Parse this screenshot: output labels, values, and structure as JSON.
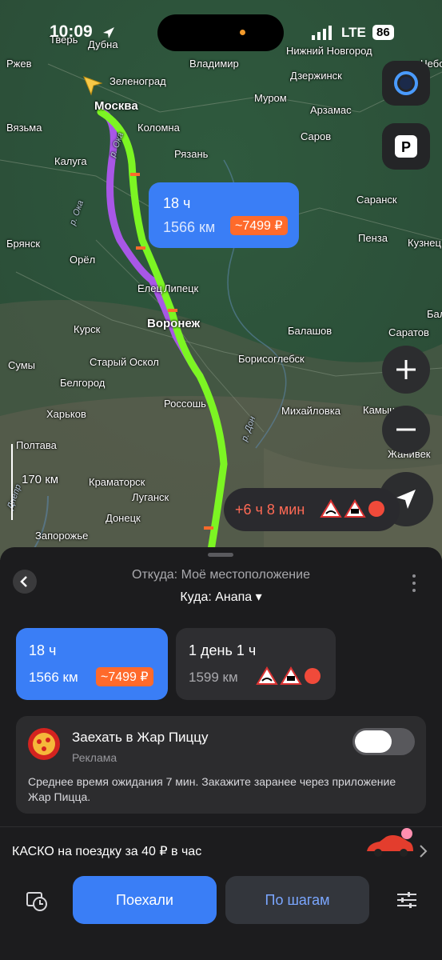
{
  "status_bar": {
    "time": "10:09",
    "network": "LTE",
    "battery": "86"
  },
  "map": {
    "cities": [
      {
        "name": "Тверь",
        "cls": ""
      },
      {
        "name": "Дубна",
        "cls": ""
      },
      {
        "name": "Ржев",
        "cls": ""
      },
      {
        "name": "Зеленоград",
        "cls": ""
      },
      {
        "name": "Москва",
        "cls": "big"
      },
      {
        "name": "Владимир",
        "cls": ""
      },
      {
        "name": "Нижний Новгород",
        "cls": ""
      },
      {
        "name": "Дзержинск",
        "cls": ""
      },
      {
        "name": "Муром",
        "cls": ""
      },
      {
        "name": "Арзамас",
        "cls": ""
      },
      {
        "name": "Вязьма",
        "cls": ""
      },
      {
        "name": "Коломна",
        "cls": ""
      },
      {
        "name": "Рязань",
        "cls": ""
      },
      {
        "name": "Саров",
        "cls": ""
      },
      {
        "name": "Калуга",
        "cls": ""
      },
      {
        "name": "Саранск",
        "cls": ""
      },
      {
        "name": "Брянск",
        "cls": ""
      },
      {
        "name": "Орёл",
        "cls": ""
      },
      {
        "name": "Пенза",
        "cls": ""
      },
      {
        "name": "Кузнец",
        "cls": ""
      },
      {
        "name": "Елец",
        "cls": ""
      },
      {
        "name": "Липецк",
        "cls": ""
      },
      {
        "name": "Воронеж",
        "cls": "big"
      },
      {
        "name": "Балашов",
        "cls": ""
      },
      {
        "name": "Саратов",
        "cls": ""
      },
      {
        "name": "Курск",
        "cls": ""
      },
      {
        "name": "Старый Оскол",
        "cls": ""
      },
      {
        "name": "Борисоглебск",
        "cls": ""
      },
      {
        "name": "Сумы",
        "cls": ""
      },
      {
        "name": "Белгород",
        "cls": ""
      },
      {
        "name": "Харьков",
        "cls": ""
      },
      {
        "name": "Россошь",
        "cls": ""
      },
      {
        "name": "Михайловка",
        "cls": ""
      },
      {
        "name": "Камышин",
        "cls": ""
      },
      {
        "name": "Полтава",
        "cls": ""
      },
      {
        "name": "Жанивек",
        "cls": ""
      },
      {
        "name": "Краматорск",
        "cls": ""
      },
      {
        "name": "Луганск",
        "cls": ""
      },
      {
        "name": "Донецк",
        "cls": ""
      },
      {
        "name": "Запорожье",
        "cls": ""
      },
      {
        "name": "Чебо",
        "cls": ""
      },
      {
        "name": "Бала",
        "cls": ""
      },
      {
        "name": "р. Ока",
        "cls": "river"
      },
      {
        "name": "р. Ока",
        "cls": "river"
      },
      {
        "name": "р. Дон",
        "cls": "river"
      },
      {
        "name": "Днепр",
        "cls": "river"
      }
    ],
    "scale_label": "170 км",
    "route_bubble": {
      "time": "18 ч",
      "distance": "1566 км",
      "price": "~7499 ₽"
    },
    "delay_pill": "+6 ч 8 мин"
  },
  "sheet": {
    "from": "Откуда: Моё местоположение",
    "to": "Куда: Анапа ▾",
    "routes": [
      {
        "time": "18 ч",
        "distance": "1566 км",
        "price": "~7499 ₽",
        "selected": true
      },
      {
        "time": "1 день 1 ч",
        "distance": "1599 км",
        "selected": false
      }
    ],
    "promo": {
      "title": "Заехать в Жар Пиццу",
      "subtitle": "Реклама",
      "description": "Среднее время ожидания 7 мин. Закажите заранее через приложение Жар Пицца.",
      "logo_text": "ЖАР ПИЦЦА",
      "toggle_on": false
    },
    "kasko_text": "КАСКО на поездку за 40 ₽ в час",
    "go_button": "Поехали",
    "steps_button": "По шагам"
  },
  "colors": {
    "accent": "#3a7ef6",
    "route_main": "#7cf523",
    "route_alt": "#a857e6",
    "price_badge": "#ff6a2b",
    "delay_text": "#ff6a55"
  }
}
